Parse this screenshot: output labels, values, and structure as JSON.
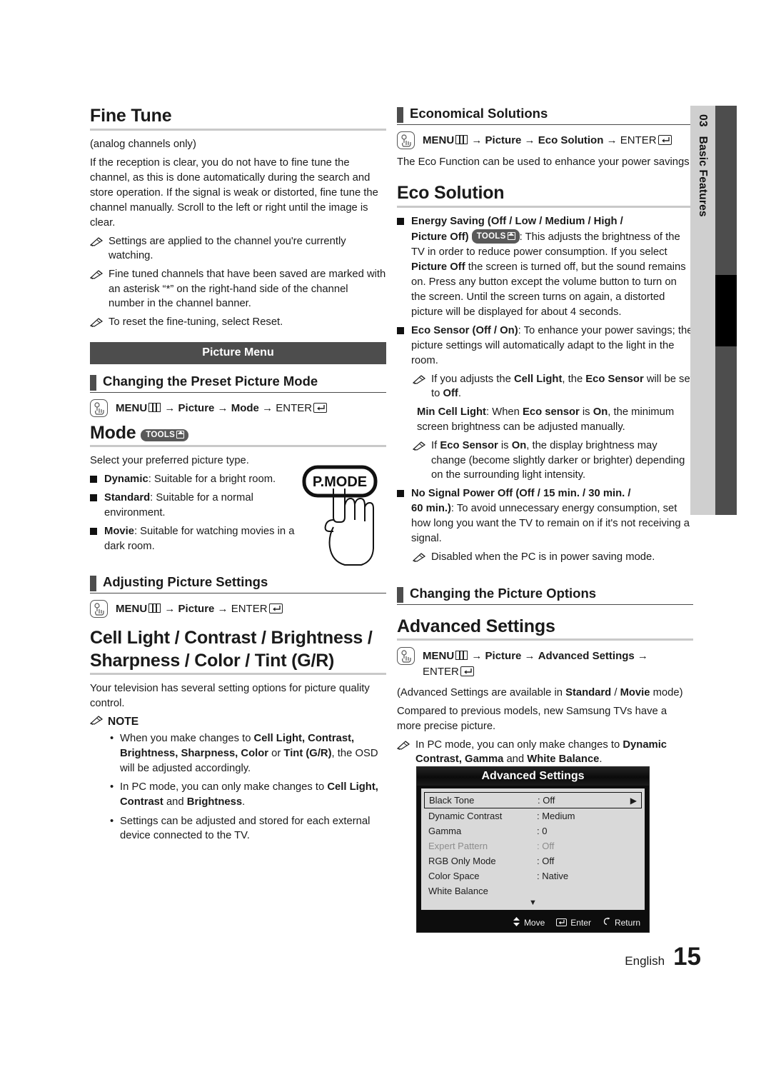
{
  "side_tab": {
    "number": "03",
    "label": "Basic Features"
  },
  "footer": {
    "language": "English",
    "page": "15"
  },
  "left_column": {
    "fine_tune": {
      "title": "Fine Tune",
      "subtitle": "(analog channels only)",
      "body": "If the reception is clear, you do not have to fine tune the channel, as this is done automatically during the search and store operation. If the signal is weak or distorted, fine tune the channel manually. Scroll to the left or right until the image is clear.",
      "notes": [
        "Settings are applied to the channel you're currently watching.",
        "Fine tuned channels that have been saved are marked with an asterisk “*” on the right-hand side of the channel number in the channel banner.",
        "To reset the fine-tuning, select Reset."
      ]
    },
    "banner": "Picture Menu",
    "preset_mode": {
      "section_title": "Changing the Preset Picture Mode",
      "nav": {
        "menu": "MENU",
        "picture": "Picture",
        "mode": "Mode",
        "enter": "ENTER"
      }
    },
    "mode": {
      "title": "Mode",
      "tools_badge": "TOOLS",
      "intro": "Select your preferred picture type.",
      "options": [
        {
          "name": "Dynamic",
          "desc": ": Suitable for a bright room."
        },
        {
          "name": "Standard",
          "desc": ": Suitable for a normal environment."
        },
        {
          "name": "Movie",
          "desc": ": Suitable for watching movies in a dark room."
        }
      ],
      "remote_button": "P.MODE"
    },
    "adjusting": {
      "section_title": "Adjusting Picture Settings",
      "nav": {
        "menu": "MENU",
        "picture": "Picture",
        "enter": "ENTER"
      }
    },
    "cell_light": {
      "title_line1": "Cell Light / Contrast / Brightness /",
      "title_line2": "Sharpness / Color / Tint (G/R)",
      "body": "Your television has several setting options for picture quality control.",
      "note_header": "NOTE",
      "bullets": [
        "When you make changes to Cell Light, Contrast, Brightness, Sharpness, Color or Tint (G/R), the OSD will be adjusted accordingly.",
        "In PC mode, you can only make changes to Cell Light, Contrast and Brightness.",
        "Settings can be adjusted and stored for each external device connected to the TV."
      ]
    }
  },
  "right_column": {
    "economical": {
      "section_title": "Economical Solutions",
      "nav": {
        "menu": "MENU",
        "picture": "Picture",
        "eco": "Eco Solution",
        "enter": "ENTER"
      },
      "body": "The Eco Function can be used to enhance your power savings."
    },
    "eco_solution": {
      "title": "Eco Solution",
      "tools_badge": "TOOLS",
      "energy_saving": {
        "label_line1": "Energy Saving (Off / Low / Medium / High /",
        "label_line2": "Picture Off)",
        "text": ": This adjusts the brightness of the TV in order to reduce power consumption. If you select Picture Off the screen is turned off, but the sound remains on. Press any button except the volume button to turn on the screen. Until the screen turns on again, a distorted picture will be displayed for about 4 seconds."
      },
      "eco_sensor": {
        "label": "Eco Sensor (Off / On)",
        "text": ": To enhance your power savings; the picture settings will automatically adapt to the light in the room.",
        "note": "If you adjusts the Cell Light, the Eco Sensor will be set to Off."
      },
      "min_cell_light": {
        "label": "Min Cell Light",
        "text": ": When Eco sensor is On, the minimum screen brightness can be adjusted manually.",
        "note": "If Eco Sensor is On, the display brightness may change (become slightly darker or brighter) depending on the surrounding light intensity."
      },
      "no_signal": {
        "label_line1": "No Signal Power Off (Off / 15 min. / 30 min. /",
        "label_line2": "60 min.)",
        "text": ": To avoid unnecessary energy consumption, set how long you want the TV to remain on if it's not receiving a signal.",
        "note": "Disabled when the PC is in power saving mode."
      }
    },
    "picture_options": {
      "section_title": "Changing the Picture Options"
    },
    "advanced": {
      "title": "Advanced Settings",
      "nav": {
        "menu": "MENU",
        "picture": "Picture",
        "advanced": "Advanced Settings",
        "enter": "ENTER"
      },
      "body1": "(Advanced Settings are available in Standard / Movie mode)",
      "body2": "Compared to previous models, new Samsung TVs have a more precise picture.",
      "note": "In PC mode, you can only make changes to Dynamic Contrast, Gamma and White Balance."
    }
  },
  "osd": {
    "title": "Advanced Settings",
    "rows": [
      {
        "name": "Black Tone",
        "value": ": Off",
        "selected": true,
        "dim": false,
        "arrow": "▶"
      },
      {
        "name": "Dynamic Contrast",
        "value": ": Medium",
        "selected": false,
        "dim": false,
        "arrow": ""
      },
      {
        "name": "Gamma",
        "value": ": 0",
        "selected": false,
        "dim": false,
        "arrow": ""
      },
      {
        "name": "Expert Pattern",
        "value": ": Off",
        "selected": false,
        "dim": true,
        "arrow": ""
      },
      {
        "name": "RGB Only Mode",
        "value": ": Off",
        "selected": false,
        "dim": false,
        "arrow": ""
      },
      {
        "name": "Color Space",
        "value": ": Native",
        "selected": false,
        "dim": false,
        "arrow": ""
      },
      {
        "name": "White Balance",
        "value": "",
        "selected": false,
        "dim": false,
        "arrow": ""
      }
    ],
    "scroll_down": "▼",
    "footer": {
      "move": "Move",
      "enter": "Enter",
      "return": "Return"
    }
  }
}
